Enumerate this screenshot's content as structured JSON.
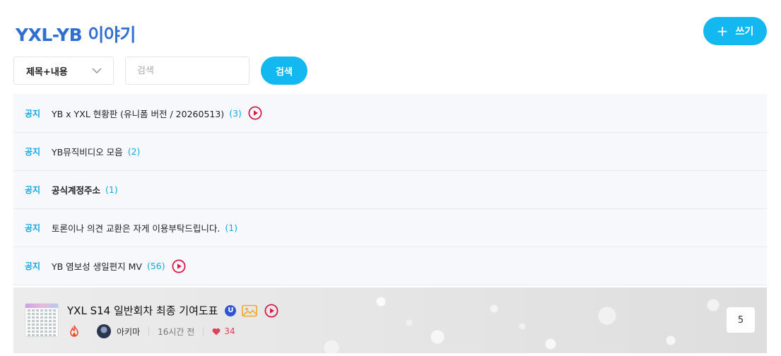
{
  "board": {
    "title": "YXL-YB 이야기",
    "write_label": "쓰기",
    "write_icon": "plus-icon"
  },
  "search": {
    "scope_selected": "제목+내용",
    "placeholder": "검색",
    "button_label": "검색"
  },
  "notices": [
    {
      "tag": "공지",
      "title": "YB x YXL 현황판 (유니폼 버전 / 20260513)",
      "comments": "(3)",
      "has_video": true,
      "bold": false
    },
    {
      "tag": "공지",
      "title": "YB뮤직비디오 모음",
      "comments": "(2)",
      "has_video": false,
      "bold": false
    },
    {
      "tag": "공지",
      "title": "공식계정주소",
      "comments": "(1)",
      "has_video": false,
      "bold": true
    },
    {
      "tag": "공지",
      "title": "토론이나 의견 교환은 자게 이용부탁드립니다.",
      "comments": "(1)",
      "has_video": false,
      "bold": false
    },
    {
      "tag": "공지",
      "title": "YB 염보성 생일편지 MV",
      "comments": "(56)",
      "has_video": true,
      "bold": false
    }
  ],
  "post": {
    "title": "YXL S14 일반회차 최종 기여도표",
    "badge": "U",
    "icons": [
      "image-icon",
      "play-icon"
    ],
    "hot_icon": "fire-icon",
    "author": "아키마",
    "time": "16시간 전",
    "likes": "34",
    "replies": "5"
  },
  "colors": {
    "accent": "#14b8f0",
    "title_blue": "#2f6fd0",
    "video_red": "#d81b4a",
    "like_red": "#e0405a"
  }
}
